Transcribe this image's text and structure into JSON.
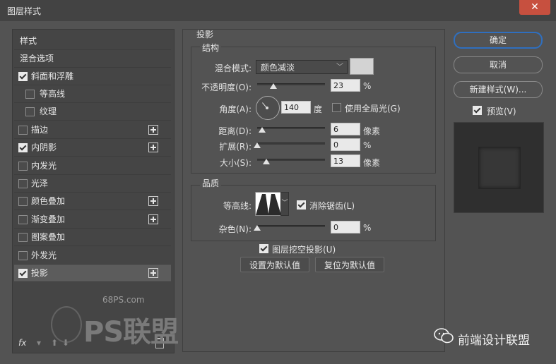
{
  "window": {
    "title": "图层样式",
    "close_icon": "✕"
  },
  "left_panel": {
    "items": [
      {
        "label": "样式",
        "checkbox": false,
        "has_checkbox": false,
        "plus": false,
        "selected": false
      },
      {
        "label": "混合选项",
        "checkbox": false,
        "has_checkbox": false,
        "plus": false,
        "selected": false
      },
      {
        "label": "斜面和浮雕",
        "checkbox": true,
        "has_checkbox": true,
        "plus": false,
        "selected": false
      },
      {
        "label": "等高线",
        "checkbox": false,
        "has_checkbox": true,
        "plus": false,
        "selected": false,
        "indent": true
      },
      {
        "label": "纹理",
        "checkbox": false,
        "has_checkbox": true,
        "plus": false,
        "selected": false,
        "indent": true
      },
      {
        "label": "描边",
        "checkbox": false,
        "has_checkbox": true,
        "plus": true,
        "selected": false
      },
      {
        "label": "内阴影",
        "checkbox": true,
        "has_checkbox": true,
        "plus": true,
        "selected": false
      },
      {
        "label": "内发光",
        "checkbox": false,
        "has_checkbox": true,
        "plus": false,
        "selected": false
      },
      {
        "label": "光泽",
        "checkbox": false,
        "has_checkbox": true,
        "plus": false,
        "selected": false
      },
      {
        "label": "颜色叠加",
        "checkbox": false,
        "has_checkbox": true,
        "plus": true,
        "selected": false
      },
      {
        "label": "渐变叠加",
        "checkbox": false,
        "has_checkbox": true,
        "plus": true,
        "selected": false
      },
      {
        "label": "图案叠加",
        "checkbox": false,
        "has_checkbox": true,
        "plus": false,
        "selected": false
      },
      {
        "label": "外发光",
        "checkbox": false,
        "has_checkbox": true,
        "plus": false,
        "selected": false
      },
      {
        "label": "投影",
        "checkbox": true,
        "has_checkbox": true,
        "plus": true,
        "selected": true
      }
    ],
    "fx_label": "fx"
  },
  "watermark": {
    "url": "68PS.com",
    "brand": "PS联盟"
  },
  "drop_shadow": {
    "section_title": "投影",
    "structure": {
      "title": "结构",
      "blend_mode_label": "混合模式:",
      "blend_mode_value": "颜色减淡",
      "opacity_label": "不透明度(O):",
      "opacity_value": "23",
      "opacity_unit": "%",
      "angle_label": "角度(A):",
      "angle_value": "140",
      "angle_unit": "度",
      "global_light_label": "使用全局光(G)",
      "global_light_checked": false,
      "distance_label": "距离(D):",
      "distance_value": "6",
      "distance_unit": "像素",
      "spread_label": "扩展(R):",
      "spread_value": "0",
      "spread_unit": "%",
      "size_label": "大小(S):",
      "size_value": "13",
      "size_unit": "像素",
      "shadow_color": "#d3d3d3"
    },
    "quality": {
      "title": "品质",
      "contour_label": "等高线:",
      "antialias_label": "消除锯齿(L)",
      "antialias_checked": true,
      "noise_label": "杂色(N):",
      "noise_value": "0",
      "noise_unit": "%"
    },
    "knockout_label": "图层挖空投影(U)",
    "knockout_checked": true,
    "set_default_label": "设置为默认值",
    "reset_default_label": "复位为默认值"
  },
  "right_panel": {
    "ok_label": "确定",
    "cancel_label": "取消",
    "new_style_label": "新建样式(W)...",
    "preview_label": "预览(V)",
    "preview_checked": true
  },
  "footer_watermark": {
    "text": "前端设计联盟"
  },
  "colors": {
    "accent": "#2f6fbf",
    "dialog_bg": "#535353",
    "close_red": "#c7503f"
  }
}
